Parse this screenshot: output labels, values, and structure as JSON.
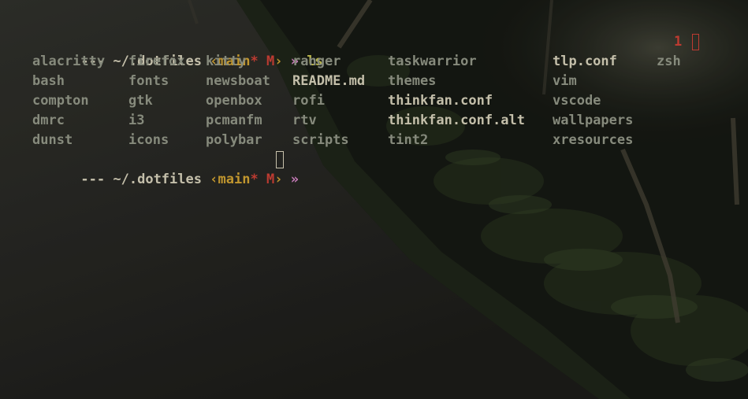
{
  "colors": {
    "dash": "#c4bfaa",
    "path": "#c4bfaa",
    "git": "#c1962e",
    "modified": "#bd3b31",
    "arrow": "#c67bb8",
    "command": "#b7b34a",
    "directory": "#868a7c",
    "file": "#c4bfaa",
    "status": "#bd3b31"
  },
  "prompt1": {
    "dashes": "---",
    "path": "~/.dotfiles",
    "git_open": "‹",
    "branch": "main",
    "dirty": "*",
    "modified": "M",
    "git_close": "›",
    "arrow": "»",
    "command": "ls"
  },
  "status": {
    "exit_code": "1"
  },
  "listing": [
    [
      {
        "name": "alacritty",
        "type": "dir"
      },
      {
        "name": "firefox",
        "type": "dir"
      },
      {
        "name": "kitty",
        "type": "dir"
      },
      {
        "name": "ranger",
        "type": "dir"
      },
      {
        "name": "taskwarrior",
        "type": "dir"
      },
      {
        "name": "tlp.conf",
        "type": "file"
      },
      {
        "name": "zsh",
        "type": "dir"
      }
    ],
    [
      {
        "name": "bash",
        "type": "dir"
      },
      {
        "name": "fonts",
        "type": "dir"
      },
      {
        "name": "newsboat",
        "type": "dir"
      },
      {
        "name": "README.md",
        "type": "file"
      },
      {
        "name": "themes",
        "type": "dir"
      },
      {
        "name": "vim",
        "type": "dir"
      }
    ],
    [
      {
        "name": "compton",
        "type": "dir"
      },
      {
        "name": "gtk",
        "type": "dir"
      },
      {
        "name": "openbox",
        "type": "dir"
      },
      {
        "name": "rofi",
        "type": "dir"
      },
      {
        "name": "thinkfan.conf",
        "type": "file"
      },
      {
        "name": "vscode",
        "type": "dir"
      }
    ],
    [
      {
        "name": "dmrc",
        "type": "dir"
      },
      {
        "name": "i3",
        "type": "dir"
      },
      {
        "name": "pcmanfm",
        "type": "dir"
      },
      {
        "name": "rtv",
        "type": "dir"
      },
      {
        "name": "thinkfan.conf.alt",
        "type": "file"
      },
      {
        "name": "wallpapers",
        "type": "dir"
      }
    ],
    [
      {
        "name": "dunst",
        "type": "dir"
      },
      {
        "name": "icons",
        "type": "dir"
      },
      {
        "name": "polybar",
        "type": "dir"
      },
      {
        "name": "scripts",
        "type": "dir"
      },
      {
        "name": "tint2",
        "type": "dir"
      },
      {
        "name": "xresources",
        "type": "dir"
      }
    ]
  ],
  "prompt2": {
    "dashes": "---",
    "path": "~/.dotfiles",
    "git_open": "‹",
    "branch": "main",
    "dirty": "*",
    "modified": "M",
    "git_close": "›",
    "arrow": "»"
  }
}
